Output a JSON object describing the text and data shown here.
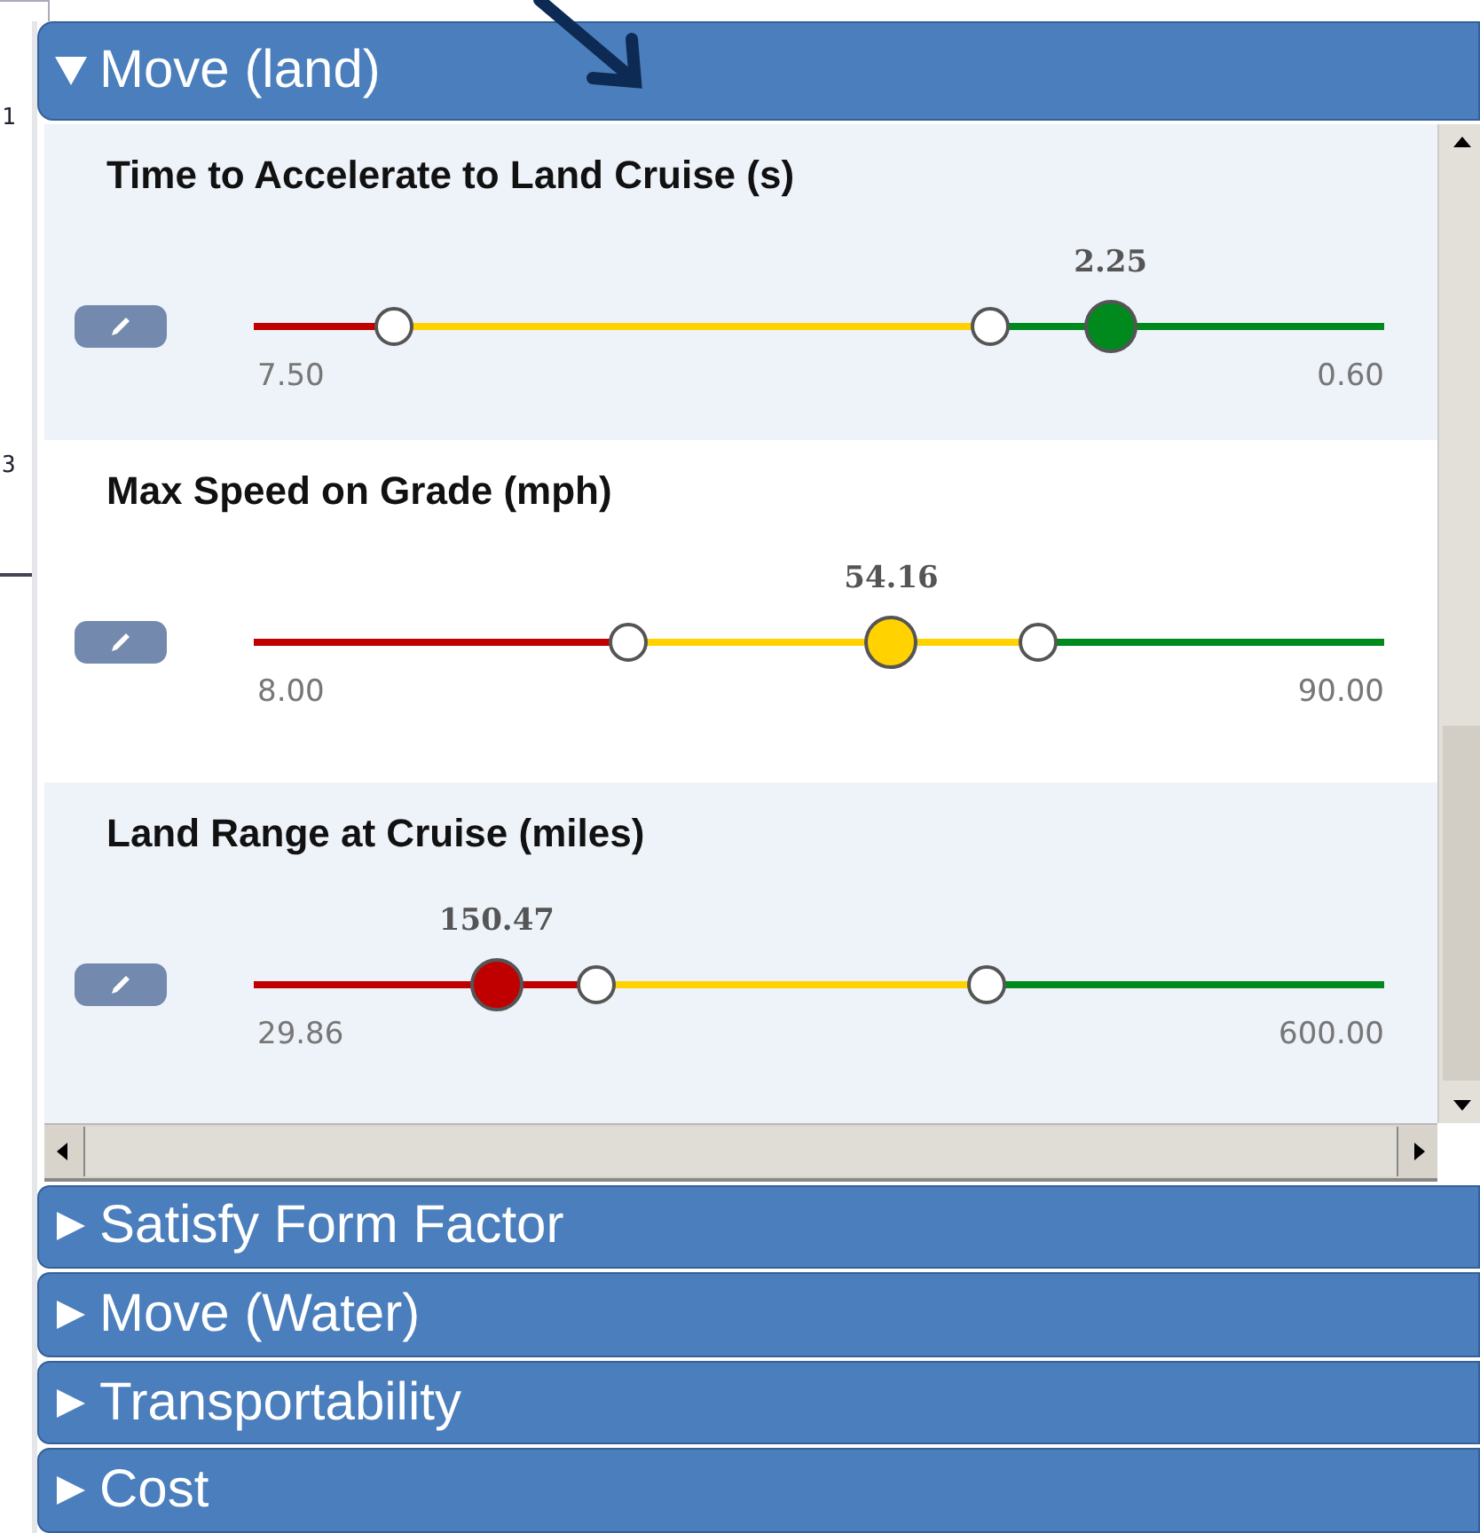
{
  "background_window": {
    "fragments": [
      "1",
      "3"
    ]
  },
  "accordion": [
    {
      "title": "Move (land)",
      "expanded": true,
      "metrics": [
        {
          "label": "Time to Accelerate to Land Cruise (s)",
          "min": "7.50",
          "max": "0.60",
          "value": "2.25",
          "level": 0.758,
          "markers": [
            {
              "level": 0.124
            },
            {
              "level": 0.651
            }
          ]
        },
        {
          "label": "Max Speed on Grade (mph)",
          "min": "8.00",
          "max": "90.00",
          "value": "54.16",
          "level": 0.564,
          "markers": [
            {
              "level": 0.331
            },
            {
              "level": 0.694
            }
          ]
        },
        {
          "label": "Land Range at Cruise (miles)",
          "min": "29.86",
          "max": "600.00",
          "value": "150.47",
          "level": 0.215,
          "markers": [
            {
              "level": 0.303
            },
            {
              "level": 0.648
            }
          ]
        }
      ]
    },
    {
      "title": "Satisfy Form Factor",
      "expanded": false
    },
    {
      "title": "Move (Water)",
      "expanded": false
    },
    {
      "title": "Transportability",
      "expanded": false
    },
    {
      "title": "Cost",
      "expanded": false
    }
  ]
}
